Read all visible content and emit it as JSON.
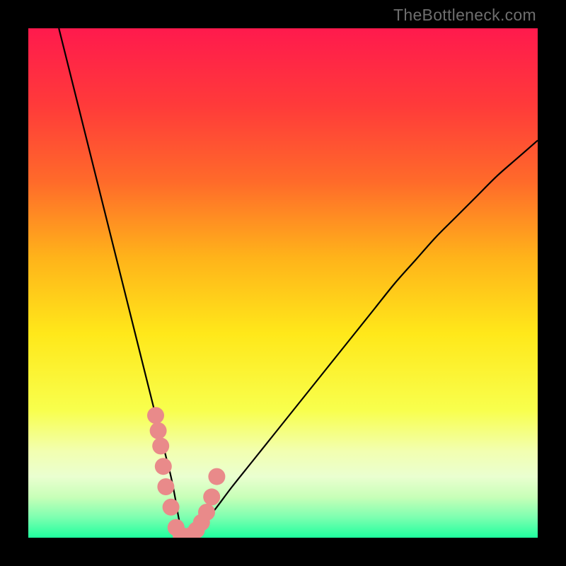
{
  "watermark": "TheBottleneck.com",
  "chart_data": {
    "type": "line",
    "title": "",
    "xlabel": "",
    "ylabel": "",
    "xlim": [
      0,
      100
    ],
    "ylim": [
      0,
      100
    ],
    "background_gradient_stops": [
      {
        "offset": 0.0,
        "color": "#ff1a4d"
      },
      {
        "offset": 0.15,
        "color": "#ff3a3a"
      },
      {
        "offset": 0.3,
        "color": "#ff6a2a"
      },
      {
        "offset": 0.45,
        "color": "#ffb31a"
      },
      {
        "offset": 0.6,
        "color": "#ffe81a"
      },
      {
        "offset": 0.75,
        "color": "#f8ff4d"
      },
      {
        "offset": 0.83,
        "color": "#f2ffb0"
      },
      {
        "offset": 0.88,
        "color": "#eaffd0"
      },
      {
        "offset": 0.92,
        "color": "#c8ffb8"
      },
      {
        "offset": 0.96,
        "color": "#7dffb0"
      },
      {
        "offset": 1.0,
        "color": "#1fff9e"
      }
    ],
    "series": [
      {
        "name": "curve",
        "stroke": "#000000",
        "x": [
          6,
          8,
          10,
          12,
          14,
          16,
          18,
          20,
          22,
          24,
          25,
          26,
          27,
          28,
          28.8,
          29.5,
          30.2,
          31,
          32,
          33,
          34,
          35,
          37,
          40,
          44,
          48,
          52,
          56,
          60,
          64,
          68,
          72,
          76,
          80,
          84,
          88,
          92,
          96,
          100
        ],
        "y": [
          100,
          92,
          84,
          76,
          68,
          60,
          52,
          44,
          36,
          28,
          24,
          20,
          16,
          12,
          8,
          4,
          1,
          0,
          0.5,
          1,
          2,
          3.5,
          6,
          10,
          15,
          20,
          25,
          30,
          35,
          40,
          45,
          50,
          54.5,
          59,
          63,
          67,
          71,
          74.5,
          78
        ]
      }
    ],
    "markers": {
      "color": "#e98a8a",
      "radius": 12,
      "points": [
        {
          "x": 25.0,
          "y": 24
        },
        {
          "x": 25.5,
          "y": 21
        },
        {
          "x": 26.0,
          "y": 18
        },
        {
          "x": 26.5,
          "y": 14
        },
        {
          "x": 27.0,
          "y": 10
        },
        {
          "x": 28.0,
          "y": 6
        },
        {
          "x": 29.0,
          "y": 2
        },
        {
          "x": 30.0,
          "y": 0.5
        },
        {
          "x": 31.0,
          "y": 0
        },
        {
          "x": 32.0,
          "y": 0.5
        },
        {
          "x": 33.0,
          "y": 1.5
        },
        {
          "x": 34.0,
          "y": 3
        },
        {
          "x": 35.0,
          "y": 5
        },
        {
          "x": 36.0,
          "y": 8
        },
        {
          "x": 37.0,
          "y": 12
        }
      ]
    }
  }
}
